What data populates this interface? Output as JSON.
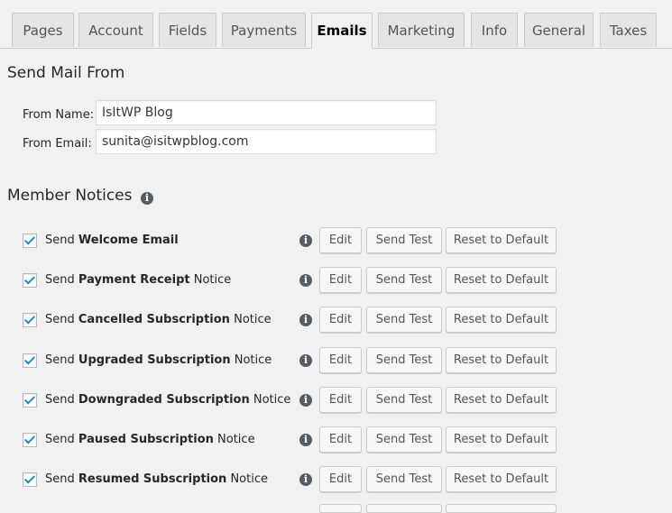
{
  "tabs": [
    {
      "label": "Pages",
      "active": false
    },
    {
      "label": "Account",
      "active": false
    },
    {
      "label": "Fields",
      "active": false
    },
    {
      "label": "Payments",
      "active": false
    },
    {
      "label": "Emails",
      "active": true
    },
    {
      "label": "Marketing",
      "active": false
    },
    {
      "label": "Info",
      "active": false
    },
    {
      "label": "General",
      "active": false
    },
    {
      "label": "Taxes",
      "active": false
    }
  ],
  "send_mail_from": {
    "heading": "Send Mail From",
    "from_name_label": "From Name:",
    "from_name_value": "IsItWP Blog",
    "from_email_label": "From Email:",
    "from_email_value": "sunita@isitwpblog.com"
  },
  "member_notices": {
    "heading": "Member Notices",
    "buttons": {
      "edit": "Edit",
      "send_test": "Send Test",
      "reset": "Reset to Default"
    },
    "items": [
      {
        "prefix": "Send",
        "bold": "Welcome Email",
        "suffix": "",
        "checked": true
      },
      {
        "prefix": "Send",
        "bold": "Payment Receipt",
        "suffix": "Notice",
        "checked": true
      },
      {
        "prefix": "Send",
        "bold": "Cancelled Subscription",
        "suffix": "Notice",
        "checked": true
      },
      {
        "prefix": "Send",
        "bold": "Upgraded Subscription",
        "suffix": "Notice",
        "checked": true
      },
      {
        "prefix": "Send",
        "bold": "Downgraded Subscription",
        "suffix": "Notice",
        "checked": true
      },
      {
        "prefix": "Send",
        "bold": "Paused Subscription",
        "suffix": "Notice",
        "checked": true
      },
      {
        "prefix": "Send",
        "bold": "Resumed Subscription",
        "suffix": "Notice",
        "checked": true
      }
    ]
  },
  "icons": {
    "info": "info-icon",
    "checkbox": "checkmark-icon"
  },
  "colors": {
    "background": "#f1f1f1",
    "checkmark": "#1e8cbe",
    "button_bg": "#f7f7f7",
    "info_icon": "#555d66"
  }
}
